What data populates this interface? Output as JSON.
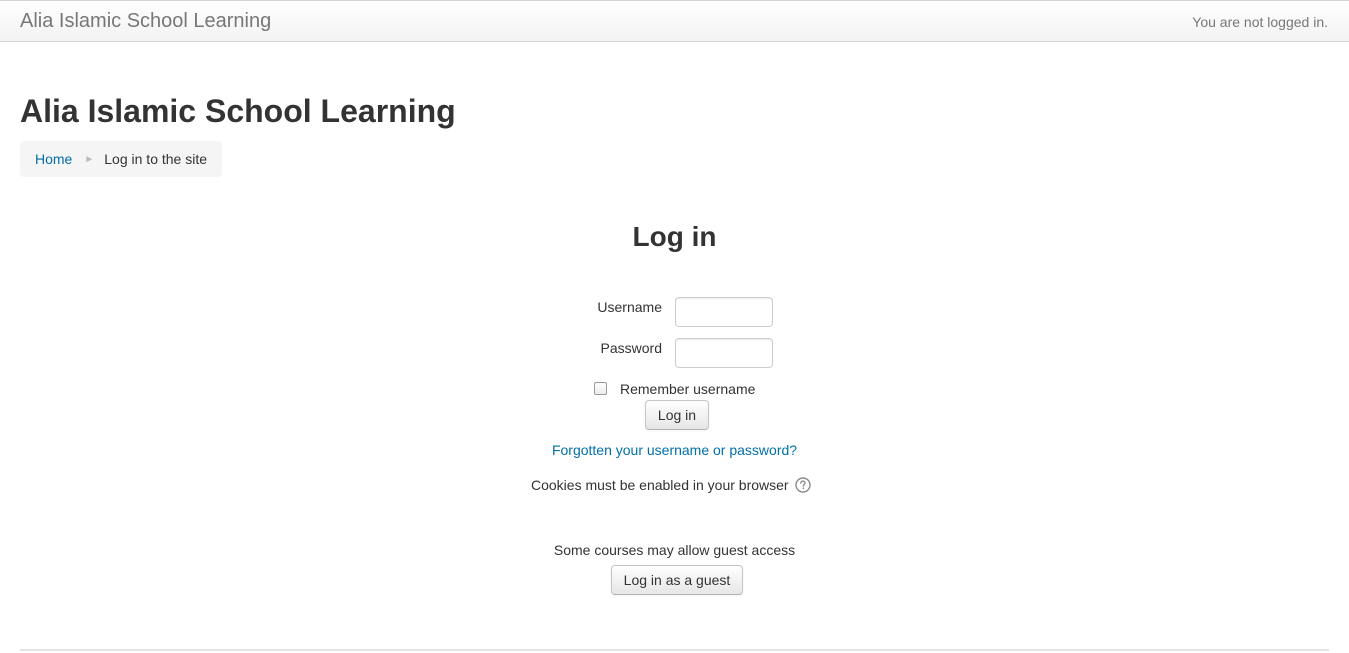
{
  "navbar": {
    "brand": "Alia Islamic School Learning",
    "login_status": "You are not logged in."
  },
  "header": {
    "title": "Alia Islamic School Learning"
  },
  "breadcrumb": {
    "home": "Home",
    "separator": "►",
    "current": "Log in to the site"
  },
  "login": {
    "heading": "Log in",
    "username_label": "Username",
    "username_value": "",
    "password_label": "Password",
    "password_value": "",
    "remember_label": "Remember username",
    "remember_checked": false,
    "submit_label": "Log in",
    "forgot_link": "Forgotten your username or password?",
    "cookies_notice": "Cookies must be enabled in your browser",
    "help_icon": "question-circle-icon"
  },
  "guest": {
    "notice": "Some courses may allow guest access",
    "button_label": "Log in as a guest"
  },
  "colors": {
    "link": "#0070a8",
    "text": "#333333",
    "muted": "#777777",
    "breadcrumb_bg": "#f5f5f5"
  }
}
